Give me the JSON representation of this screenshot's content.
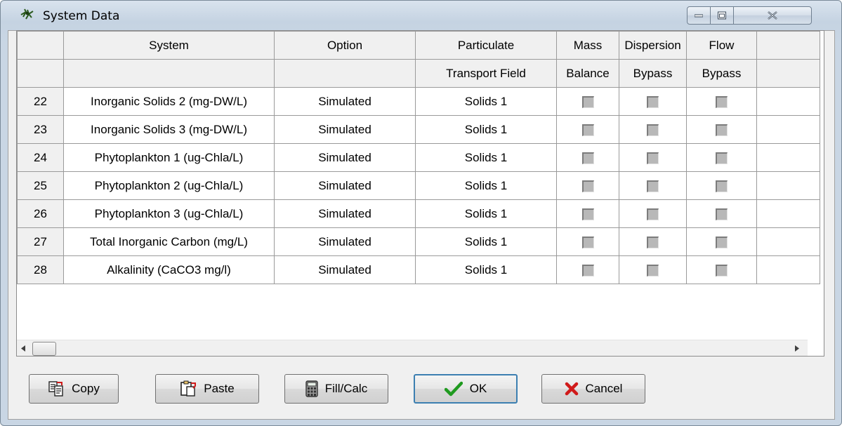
{
  "window": {
    "title": "System Data"
  },
  "grid": {
    "header_top": [
      "",
      "System",
      "Option",
      "Particulate",
      "Mass",
      "Dispersion",
      "Flow"
    ],
    "header_bottom": [
      "",
      "",
      "",
      "Transport Field",
      "Balance",
      "Bypass",
      "Bypass"
    ],
    "rows": [
      {
        "num": "22",
        "system": "Inorganic Solids 2 (mg-DW/L)",
        "option": "Simulated",
        "particulate": "Solids 1",
        "mass_balance": false,
        "dispersion_bypass": false,
        "flow_bypass": false
      },
      {
        "num": "23",
        "system": "Inorganic Solids 3 (mg-DW/L)",
        "option": "Simulated",
        "particulate": "Solids 1",
        "mass_balance": false,
        "dispersion_bypass": false,
        "flow_bypass": false
      },
      {
        "num": "24",
        "system": "Phytoplankton 1 (ug-Chla/L)",
        "option": "Simulated",
        "particulate": "Solids 1",
        "mass_balance": false,
        "dispersion_bypass": false,
        "flow_bypass": false
      },
      {
        "num": "25",
        "system": "Phytoplankton 2 (ug-Chla/L)",
        "option": "Simulated",
        "particulate": "Solids 1",
        "mass_balance": false,
        "dispersion_bypass": false,
        "flow_bypass": false
      },
      {
        "num": "26",
        "system": "Phytoplankton 3 (ug-Chla/L)",
        "option": "Simulated",
        "particulate": "Solids 1",
        "mass_balance": false,
        "dispersion_bypass": false,
        "flow_bypass": false
      },
      {
        "num": "27",
        "system": "Total Inorganic Carbon (mg/L)",
        "option": "Simulated",
        "particulate": "Solids 1",
        "mass_balance": false,
        "dispersion_bypass": false,
        "flow_bypass": false
      },
      {
        "num": "28",
        "system": "Alkalinity (CaCO3 mg/l)",
        "option": "Simulated",
        "particulate": "Solids 1",
        "mass_balance": false,
        "dispersion_bypass": false,
        "flow_bypass": false
      }
    ]
  },
  "buttons": {
    "copy": "Copy",
    "paste": "Paste",
    "fill_calc": "Fill/Calc",
    "ok": "OK",
    "cancel": "Cancel"
  },
  "icons": {
    "app": "wasp-icon",
    "minimize": "minimize-icon",
    "maximize": "maximize-icon",
    "close": "close-icon"
  }
}
